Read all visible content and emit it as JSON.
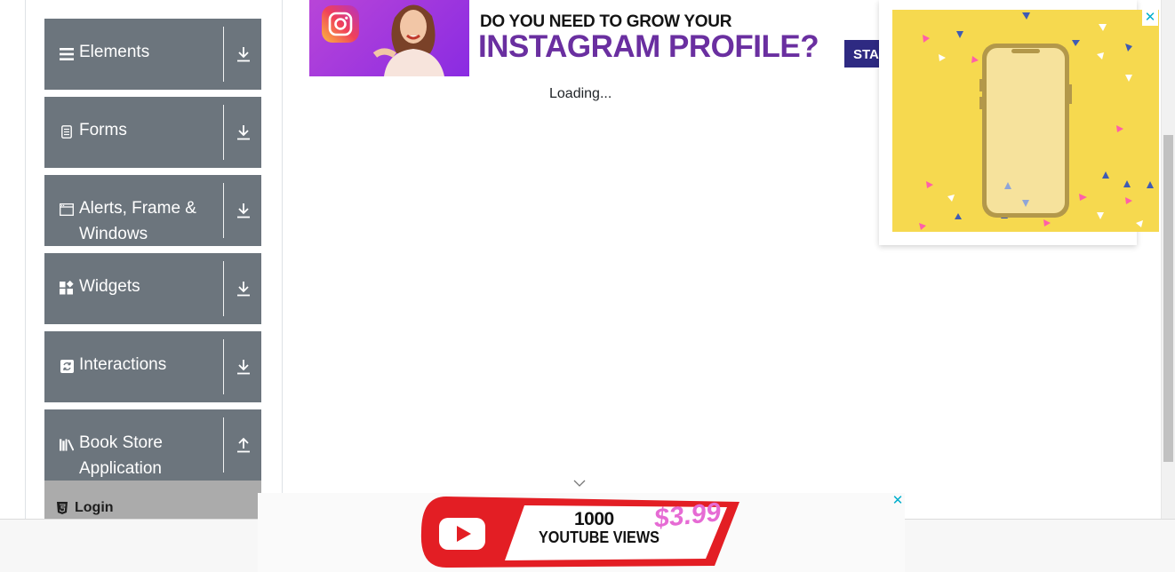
{
  "sidebar": {
    "groups": [
      {
        "label": "Elements",
        "icon": "menu-icon",
        "toggle_icon": "download-arrow-icon"
      },
      {
        "label": "Forms",
        "icon": "form-document-icon",
        "toggle_icon": "download-arrow-icon"
      },
      {
        "label_line1": "Alerts, Frame &",
        "label_line2": "Windows",
        "icon": "window-icon",
        "toggle_icon": "download-arrow-icon"
      },
      {
        "label": "Widgets",
        "icon": "widgets-icon",
        "toggle_icon": "download-arrow-icon"
      },
      {
        "label": "Interactions",
        "icon": "interactions-icon",
        "toggle_icon": "download-arrow-icon"
      },
      {
        "label_line1": "Book Store",
        "label_line2": "Application",
        "icon": "books-icon",
        "toggle_icon": "upload-arrow-icon"
      }
    ],
    "subitem": {
      "label": "Login",
      "icon": "html5-icon"
    }
  },
  "main": {
    "loading_text": "Loading..."
  },
  "ads": {
    "top_banner": {
      "line1": "DO YOU NEED TO GROW YOUR",
      "line2": "INSTAGRAM PROFILE?",
      "cta": "STA"
    },
    "side": {
      "close": "✕"
    },
    "bottom": {
      "views_number": "1000",
      "views_label": "YOUTUBE VIEWS",
      "price": "$3.99",
      "close": "✕"
    }
  },
  "colors": {
    "sidebar_group_bg": "#6c757d",
    "subitem_bg": "#ababab",
    "ad_close": "#00aecd",
    "side_ad_bg": "#f6d94f",
    "instagram_purple": "#6a2fa0"
  }
}
